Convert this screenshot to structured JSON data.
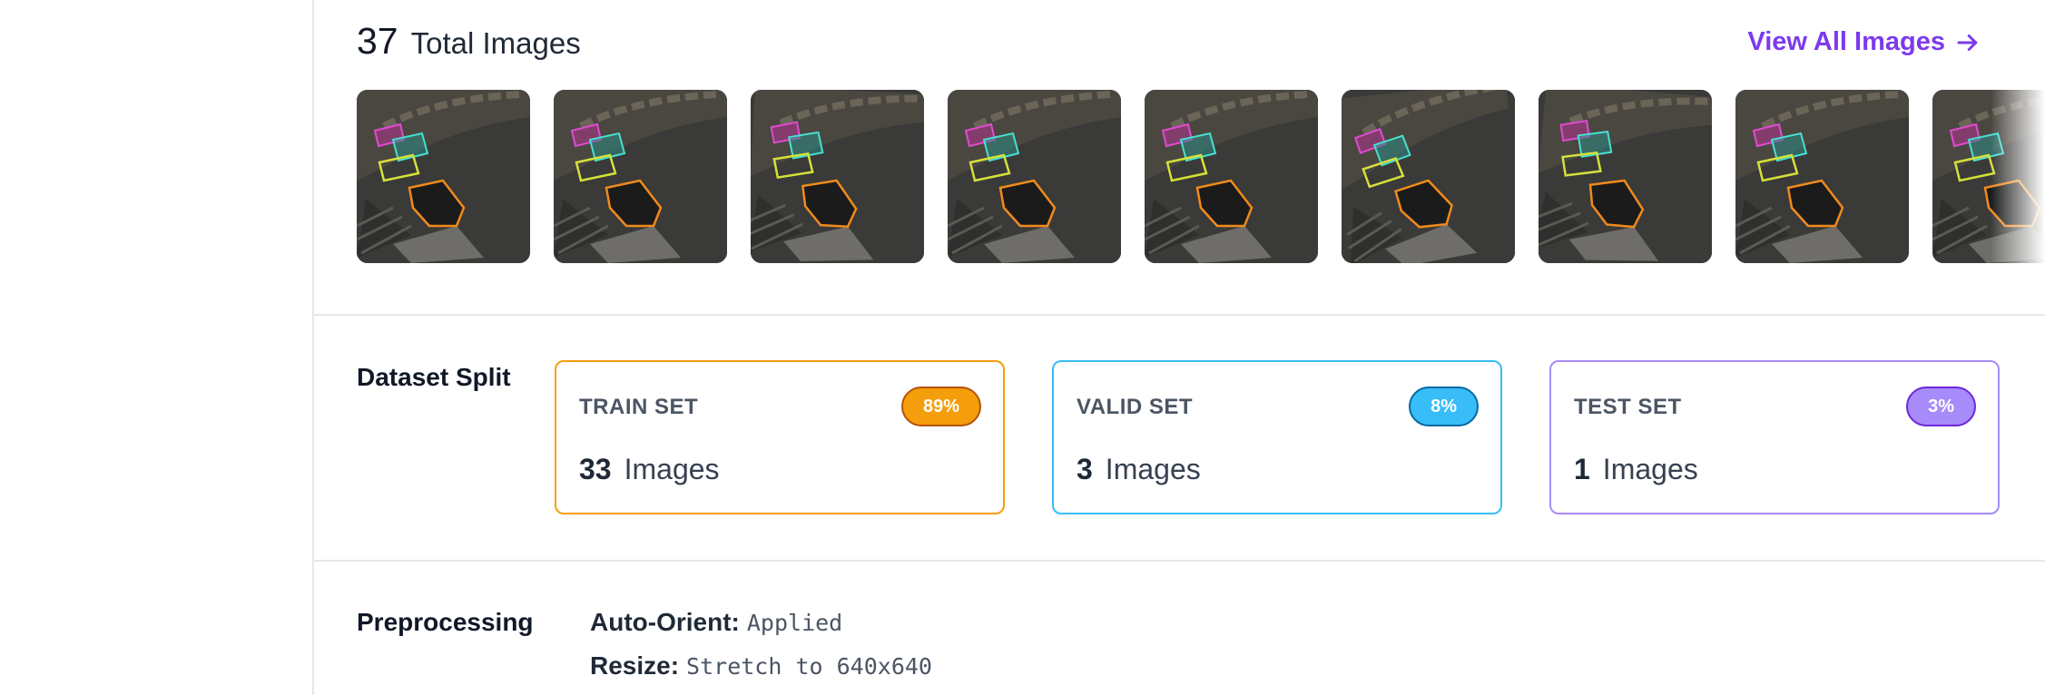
{
  "images": {
    "count": "37",
    "label": "Total Images",
    "view_all": "View All Images",
    "thumbnails": [
      {
        "name": "image-thumbnail-1"
      },
      {
        "name": "image-thumbnail-2"
      },
      {
        "name": "image-thumbnail-3"
      },
      {
        "name": "image-thumbnail-4"
      },
      {
        "name": "image-thumbnail-5"
      },
      {
        "name": "image-thumbnail-6"
      },
      {
        "name": "image-thumbnail-7"
      },
      {
        "name": "image-thumbnail-8"
      },
      {
        "name": "image-thumbnail-9"
      }
    ]
  },
  "split": {
    "title": "Dataset Split",
    "train": {
      "name": "TRAIN SET",
      "percent": "89%",
      "count": "33",
      "unit": "Images",
      "color": "#f59e0b"
    },
    "valid": {
      "name": "VALID SET",
      "percent": "8%",
      "count": "3",
      "unit": "Images",
      "color": "#38bdf8"
    },
    "test": {
      "name": "TEST SET",
      "percent": "3%",
      "count": "1",
      "unit": "Images",
      "color": "#a78bfa"
    }
  },
  "preprocessing": {
    "title": "Preprocessing",
    "auto_orient_label": "Auto-Orient:",
    "auto_orient_value": "Applied",
    "resize_label": "Resize:",
    "resize_value": "Stretch to 640x640"
  }
}
